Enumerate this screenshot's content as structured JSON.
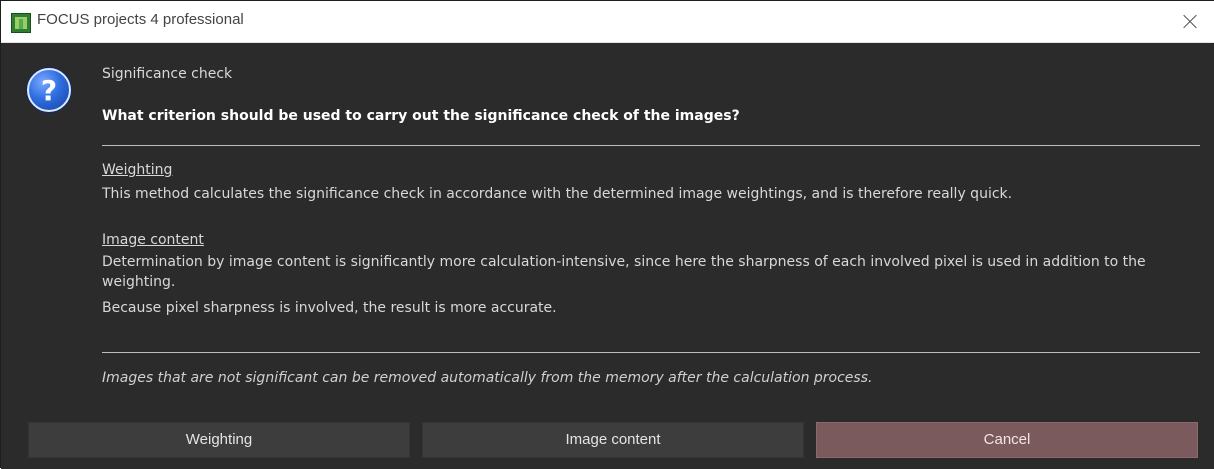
{
  "window": {
    "title": "FOCUS projects 4 professional",
    "app_icon": "focus-app-icon",
    "close_icon": "close-icon"
  },
  "dialog": {
    "icon": "question-icon",
    "icon_glyph": "?",
    "subtitle": "Significance check",
    "question": "What criterion should be used to carry out the significance check of the images?",
    "sections": [
      {
        "heading": "Weighting",
        "lines": [
          "This method calculates the significance check in accordance with the determined image weightings, and is therefore really quick."
        ]
      },
      {
        "heading": "Image content",
        "lines": [
          "Determination by image content is significantly more calculation-intensive, since here the sharpness of each involved pixel is used in addition to the weighting.",
          "Because pixel sharpness is involved, the result is more accurate."
        ]
      }
    ],
    "note": "Images that are not significant can be removed automatically from the memory after the calculation process."
  },
  "buttons": {
    "weighting": "Weighting",
    "image_content": "Image content",
    "cancel": "Cancel"
  },
  "colors": {
    "background": "#2b2b2b",
    "button": "#3d3d3d",
    "cancel_button": "#7a5a5d",
    "text": "#d8d8d8"
  }
}
